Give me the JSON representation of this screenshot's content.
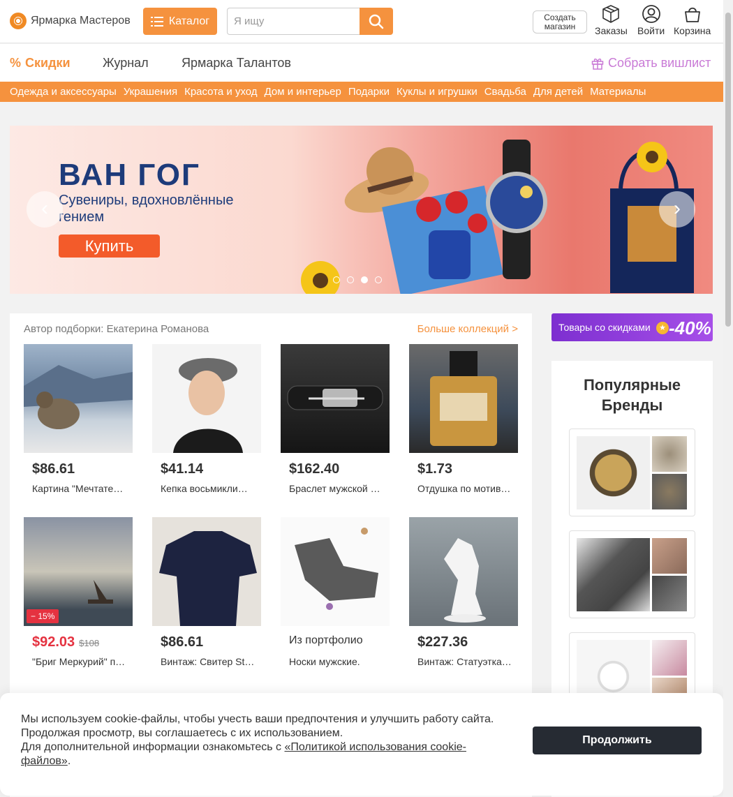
{
  "header": {
    "logo_text": "Ярмарка Мастеров",
    "catalog_label": "Каталог",
    "search_placeholder": "Я ищу",
    "create_shop_line1": "Создать",
    "create_shop_line2": "магазин",
    "orders_label": "Заказы",
    "login_label": "Войти",
    "cart_label": "Корзина"
  },
  "nav": {
    "sale": "Скидки",
    "journal": "Журнал",
    "talents": "Ярмарка Талантов",
    "wishlist": "Собрать вишлист"
  },
  "categories": [
    "Одежда и аксессуары",
    "Украшения",
    "Красота и уход",
    "Дом и интерьер",
    "Подарки",
    "Куклы и игрушки",
    "Свадьба",
    "Для детей",
    "Материалы"
  ],
  "banner": {
    "title": "ВАН ГОГ",
    "subtitle": "Сувениры, вдохновлённые гением",
    "button": "Купить",
    "prev": "‹",
    "next": "›"
  },
  "collection": {
    "author": "Автор подборки: Екатерина Романова",
    "more": "Больше коллекций >",
    "items": [
      {
        "price": "$86.61",
        "title": "Картина \"Мечтате…"
      },
      {
        "price": "$41.14",
        "title": "Кепка восьмикли…"
      },
      {
        "price": "$162.40",
        "title": "Браслет мужской …"
      },
      {
        "price": "$1.73",
        "title": "Отдушка по мотив…"
      },
      {
        "price": "$92.03",
        "old_price": "$108",
        "badge": "− 15%",
        "title": "\"Бриг Меркурий\" п…"
      },
      {
        "price": "$86.61",
        "title": "Винтаж: Свитер St…"
      },
      {
        "portfolio": "Из портфолио",
        "title": "Носки мужские."
      },
      {
        "price": "$227.36",
        "title": "Винтаж: Статуэтка…"
      }
    ]
  },
  "promo": {
    "text": "Товары со скидками",
    "percent": "-40%"
  },
  "brands": {
    "title": "Популярные Бренды"
  },
  "cookie": {
    "text": "Мы используем cookie-файлы, чтобы учесть ваши предпочтения и улучшить работу сайта. Продолжая просмотр, вы соглашаетесь с их использованием.",
    "text2": "Для дополнительной информации ознакомьтесь с ",
    "link": "«Политикой использования cookie-файлов»",
    "button": "Продолжить"
  },
  "colors": {
    "accent": "#f5923e",
    "sale": "#e53240",
    "wishlist": "#c97ad6",
    "dark_button": "#262b33"
  }
}
